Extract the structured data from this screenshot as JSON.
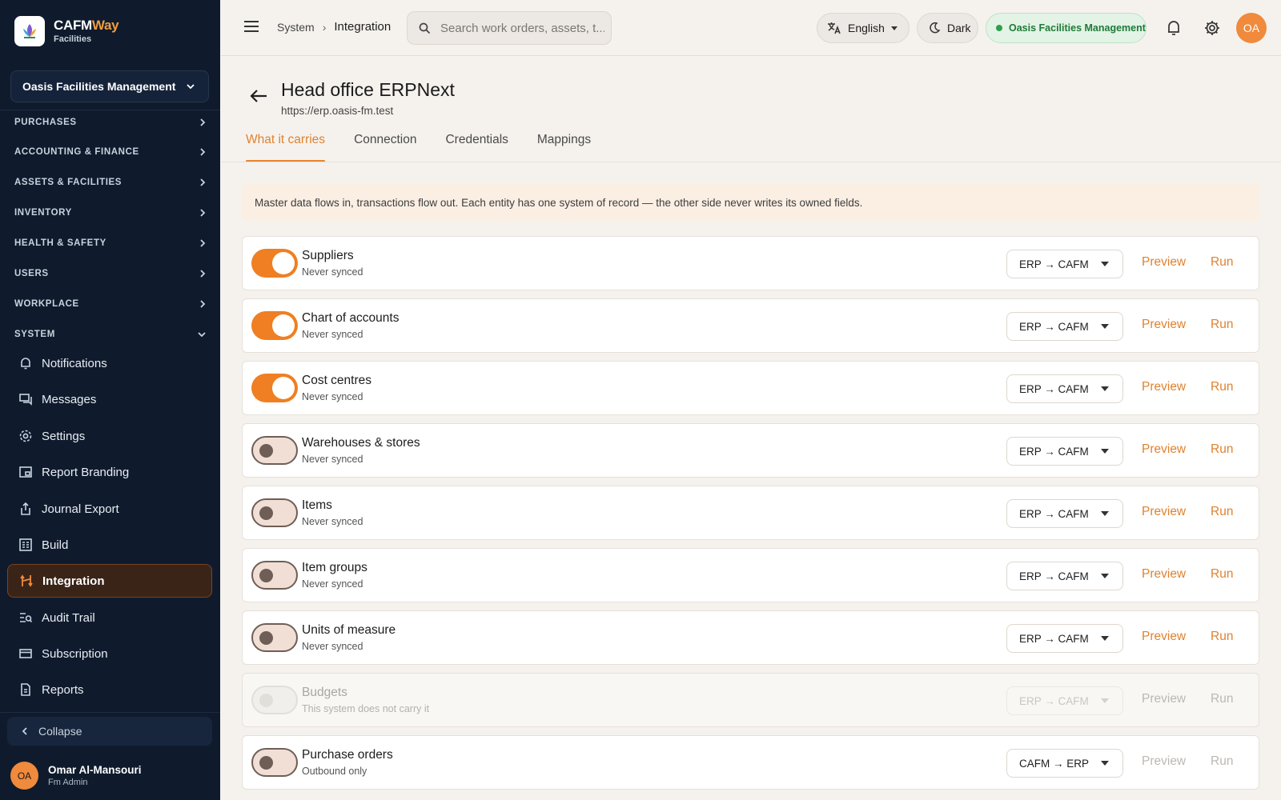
{
  "brand": {
    "name_main": "CAFM",
    "name_accent": "Way",
    "subtitle": "Facilities"
  },
  "org_selector": {
    "value": "Oasis Facilities Management"
  },
  "sidebar": {
    "sections": [
      {
        "label": "PURCHASES",
        "expanded": false
      },
      {
        "label": "ACCOUNTING & FINANCE",
        "expanded": false
      },
      {
        "label": "ASSETS & FACILITIES",
        "expanded": false
      },
      {
        "label": "INVENTORY",
        "expanded": false
      },
      {
        "label": "HEALTH & SAFETY",
        "expanded": false
      },
      {
        "label": "USERS",
        "expanded": false
      },
      {
        "label": "WORKPLACE",
        "expanded": false
      },
      {
        "label": "SYSTEM",
        "expanded": true
      }
    ],
    "items": [
      {
        "label": "Notifications",
        "icon": "bell-icon",
        "active": false
      },
      {
        "label": "Messages",
        "icon": "messages-icon",
        "active": false
      },
      {
        "label": "Settings",
        "icon": "gear-icon",
        "active": false
      },
      {
        "label": "Report Branding",
        "icon": "branding-icon",
        "active": false
      },
      {
        "label": "Journal Export",
        "icon": "export-icon",
        "active": false
      },
      {
        "label": "Build",
        "icon": "build-icon",
        "active": false
      },
      {
        "label": "Integration",
        "icon": "integration-icon",
        "active": true
      },
      {
        "label": "Audit Trail",
        "icon": "audit-icon",
        "active": false
      },
      {
        "label": "Subscription",
        "icon": "card-icon",
        "active": false
      },
      {
        "label": "Reports",
        "icon": "report-icon",
        "active": false
      }
    ],
    "collapse_label": "Collapse"
  },
  "user": {
    "initials": "OA",
    "name": "Omar Al-Mansouri",
    "role": "Fm Admin"
  },
  "topbar": {
    "breadcrumb": [
      "System",
      "Integration"
    ],
    "search_placeholder": "Search work orders, assets, t...",
    "language": "English",
    "theme": "Dark",
    "org_badge": "Oasis Facilities Management",
    "avatar_initials": "OA"
  },
  "page": {
    "title": "Head office ERPNext",
    "url": "https://erp.oasis-fm.test",
    "tabs": [
      "What it carries",
      "Connection",
      "Credentials",
      "Mappings"
    ],
    "active_tab": 0,
    "banner": "Master data flows in, transactions flow out. Each entity has one system of record — the other side never writes its owned fields."
  },
  "actions": {
    "preview": "Preview",
    "run": "Run"
  },
  "entities": [
    {
      "name": "Suppliers",
      "status": "Never synced",
      "enabled": true,
      "disabled": false,
      "direction": "ERP → CAFM",
      "actions_active": true
    },
    {
      "name": "Chart of accounts",
      "status": "Never synced",
      "enabled": true,
      "disabled": false,
      "direction": "ERP → CAFM",
      "actions_active": true
    },
    {
      "name": "Cost centres",
      "status": "Never synced",
      "enabled": true,
      "disabled": false,
      "direction": "ERP → CAFM",
      "actions_active": true
    },
    {
      "name": "Warehouses & stores",
      "status": "Never synced",
      "enabled": false,
      "disabled": false,
      "direction": "ERP → CAFM",
      "actions_active": true
    },
    {
      "name": "Items",
      "status": "Never synced",
      "enabled": false,
      "disabled": false,
      "direction": "ERP → CAFM",
      "actions_active": true
    },
    {
      "name": "Item groups",
      "status": "Never synced",
      "enabled": false,
      "disabled": false,
      "direction": "ERP → CAFM",
      "actions_active": true
    },
    {
      "name": "Units of measure",
      "status": "Never synced",
      "enabled": false,
      "disabled": false,
      "direction": "ERP → CAFM",
      "actions_active": true
    },
    {
      "name": "Budgets",
      "status": "This system does not carry it",
      "enabled": false,
      "disabled": true,
      "direction": "ERP → CAFM",
      "actions_active": false
    },
    {
      "name": "Purchase orders",
      "status": "Outbound only",
      "enabled": false,
      "disabled": false,
      "direction": "CAFM → ERP",
      "actions_active": false
    }
  ],
  "colors": {
    "accent": "#ef7f22",
    "sidebar_bg": "#0f1b2d",
    "success": "#2fa04a"
  }
}
